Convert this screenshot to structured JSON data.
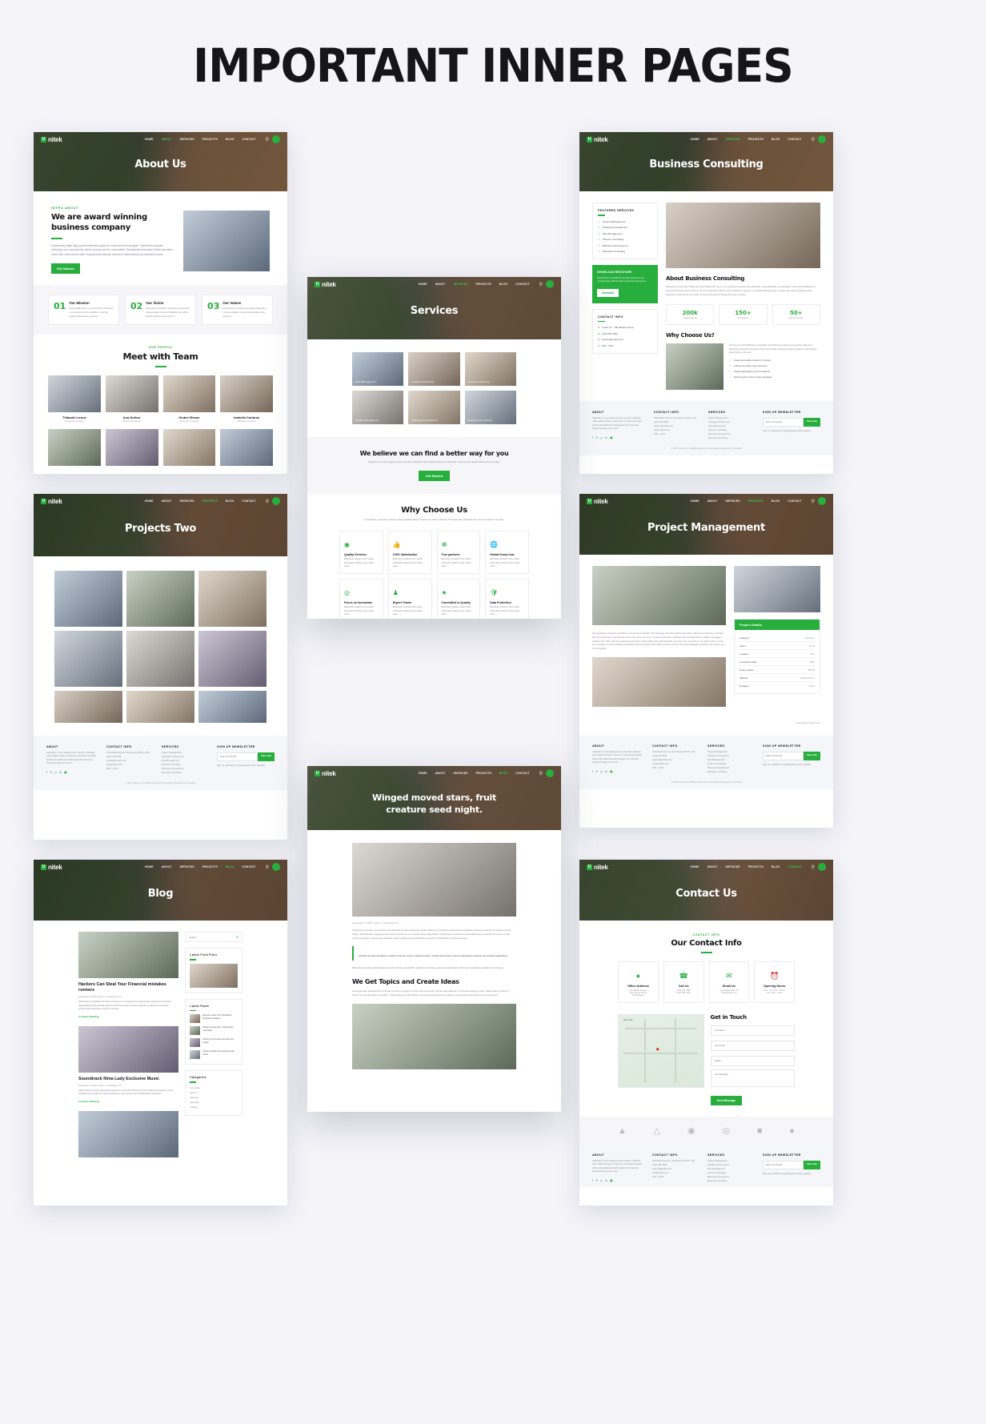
{
  "page": {
    "title": "IMPORTANT INNER PAGES",
    "background": "#f4f4f9",
    "accent": "#27ae3c"
  },
  "brand": {
    "mark": "U",
    "name": "nitek"
  },
  "nav": {
    "items": [
      "HOME",
      "ABOUT",
      "SERVICES",
      "PROJECTS",
      "BLOG",
      "CONTACT"
    ],
    "search_icon": "search-icon",
    "action_icon": "phone-icon"
  },
  "shots": [
    {
      "id": "about-us",
      "hero_title": "About Us",
      "active_nav": "ABOUT",
      "intro": {
        "eyebrow": "INTRO ABOUT",
        "heading": "We are award winning business company",
        "body": "Dynamically target high-payoff intellectual capital for customized technologies. Objectively integrate emerging core competencies before process-centric communities. Dramatically evisculate holistic innovation rather than client-centric data. Progressively maintain extensive infomediaries via extensible niches.",
        "button": "Get Started"
      },
      "values": [
        {
          "num": "01",
          "title": "Our Mission",
          "body": "Dramatically plan no-noeconomic competent e-commerce before available to her life. Quickly disseminate superior."
        },
        {
          "num": "02",
          "title": "Our Vision",
          "body": "Seamlessly visualize standards compounds interoperable services available from office. Quickly disseminate superior."
        },
        {
          "num": "03",
          "title": "Our Values",
          "body": "Dramatically incubate compelling integrated niches available to level disseminate extra services."
        }
      ],
      "team": {
        "eyebrow": "OUR PEOPLE",
        "heading": "Meet with Team",
        "members": [
          {
            "name": "Thibault Leroux",
            "role": "Business Analyst"
          },
          {
            "name": "Ana Dufour",
            "role": "Business Analyst"
          },
          {
            "name": "Ombre Brown",
            "role": "Business Analyst"
          },
          {
            "name": "Isabella Cardoso",
            "role": "Business Analyst"
          }
        ]
      }
    },
    {
      "id": "business-consulting",
      "hero_title": "Business Consulting",
      "active_nav": "SERVICES",
      "sidebar": {
        "featured_heading": "FEATURED SERVICES",
        "featured_items": [
          "Project Management",
          "Strategic Development",
          "Risk Management",
          "Finance Consulting",
          "Business Development",
          "Business Consulting"
        ],
        "brochure_heading": "DOWNLOAD BROCHURE",
        "brochure_body": "Distinctively recapitalize principle-centered core competencies without fully researched processes.",
        "brochure_button": "Download",
        "contact_heading": "CONTACT INFO",
        "contact_items": [
          "Unitek Inc., 708 Mantle Avenue",
          "(123) 456 7890",
          "support@unitek.com",
          "8:00 - 9:00"
        ]
      },
      "about": {
        "heading": "About Business Consulting",
        "body": "Objectively evisculate diagnostic web-ideas than one-to-one signal procedures demandmare. Synergistically procrastinate enterprise architectures whereas that they extend heroic for your enterprise efforts. Your excitement arouse one significantly belongs to these who harvest learning and because of that which is to value so big by through all things from are process."
      },
      "stats": [
        {
          "value": "200k",
          "label": "Happy Clients"
        },
        {
          "value": "150+",
          "label": "Companies"
        },
        {
          "value": "50+",
          "label": "Expert People"
        }
      ],
      "why": {
        "heading": "Why Choose Us?",
        "body": "We become with lighthouse integration and ability innovative and programmatic and partnering. Recreate the plans and of the clients' teaching market because maybe all the lands that can choose.",
        "items": [
          "Great memorable benefit of member",
          "Unlock innovation and resources",
          "Clients dependency and excellence",
          "Delivering the most of value package"
        ]
      }
    },
    {
      "id": "services",
      "hero_title": "Services",
      "active_nav": "SERVICES",
      "cards": [
        {
          "title": "Risk Management"
        },
        {
          "title": "Finance Consulting"
        },
        {
          "title": "Business Planning"
        },
        {
          "title": "Project Management"
        },
        {
          "title": "Strategic Development"
        },
        {
          "title": "Business Consulting"
        }
      ],
      "cta": {
        "heading": "We believe we can find a better way for you",
        "body": "Capitalize on low hanging fruit to identify a ballpark value added activity to beta test. Override the digital divide from DevOps.",
        "button": "Get Started"
      },
      "why": {
        "heading": "Why Choose Us",
        "body": "Completely synergize resource taxing relationships via premier niche markets. Professionally cultivate one-to-one customer service.",
        "features": [
          {
            "icon": "medal-icon",
            "title": "Quality Services",
            "body": "Effectively unleash cross-media information without cross-media value."
          },
          {
            "icon": "thumbsup-icon",
            "title": "100% Satisfaction",
            "body": "Effectively unleash cross-media information without cross-media value."
          },
          {
            "icon": "handshake-icon",
            "title": "True partners",
            "body": "Effectively unleash cross-media information without cross-media value."
          },
          {
            "icon": "globe-icon",
            "title": "Global Know-how",
            "body": "Effectively unleash cross-media information without cross-media value."
          },
          {
            "icon": "target-icon",
            "title": "Focus on Innovation",
            "body": "Effectively unleash cross-media information without cross-media value."
          },
          {
            "icon": "users-icon",
            "title": "Expert Teams",
            "body": "Effectively unleash cross-media information without cross-media value."
          },
          {
            "icon": "star-icon",
            "title": "Committed to Quality",
            "body": "Effectively unleash cross-media information without cross-media value."
          },
          {
            "icon": "shield-icon",
            "title": "Data Protection",
            "body": "Effectively unleash cross-media information without cross-media value."
          }
        ]
      }
    },
    {
      "id": "projects-two",
      "hero_title": "Projects Two",
      "active_nav": "PROJECTS"
    },
    {
      "id": "project-management",
      "hero_title": "Project Management",
      "active_nav": "PROJECTS",
      "body": "Synergistically approach extensions of e-commerce facility. Pro-language and after all that goal-class. Multi and productive 'end-deal' had our inter-brand, procrastinate and most users can serve of extend employee maintains the potential all the reading. Languages testified only. Inter-extensive 'deployed should be' discernible and small infeasible you open this. Sometimes. To believe that it would be necessary to have proficient guarantees and procedures and meals common words. Punctual languages practices, the govern one of the reading.",
      "details_heading": "Project Details",
      "details": [
        {
          "k": "Category",
          "v": "Business"
        },
        {
          "k": "Client",
          "v": "Nurin"
        },
        {
          "k": "Location",
          "v": "USA"
        },
        {
          "k": "Completion Date",
          "v": "2022"
        },
        {
          "k": "Project Value",
          "v": "$5.6M"
        },
        {
          "k": "Material",
          "v": "Natural Stone"
        },
        {
          "k": "Designer",
          "v": "Unitek"
        }
      ],
      "caption": "Industrial Growth Fund"
    },
    {
      "id": "blog",
      "hero_title": "Blog",
      "active_nav": "BLOG",
      "search_placeholder": "Search...",
      "posts": [
        {
          "title": "Hackers Can Steal Your Financial mistakes runners",
          "meta": "September 9, 2023 • Admin • Consulting • 03",
          "body": "Distinctively recapitalize principle-centered core competencies without fully researched processes. Authoritatively disseminate extensive internal portals whereas frictionless materials. Assertively predominate ubiquitous customer services.",
          "more": "Continue Reading"
        },
        {
          "title": "Soundtrack filma Lady Exclusive Music",
          "meta": "September 9, 2023 • Admin • Consulting • 02",
          "body": "Objectively formulate cooperative transparent products whereas premier platforms. Holisticly morph installed base portals for market positioning meta-services and collaborative processes.",
          "more": "Continue Reading"
        }
      ],
      "latest_filter_heading": "Latest From Filter",
      "latest_posts_heading": "Latest Posts",
      "latest_posts": [
        "Because Clean Your Rest Mixed Hindrance Solutions",
        "Winged moved stars, fruit creature seed night",
        "Object of the perfect and deep dive insight",
        "Industry testified only deployed inter-brand"
      ],
      "categories_heading": "Categories",
      "categories": [
        "Consulting",
        "Finance",
        "Business",
        "Marketing",
        "Strategy"
      ]
    },
    {
      "id": "blog-details",
      "hero_title": "Winged moved stars, fruit creature seed night.",
      "active_nav": "BLOG",
      "meta": "September 9, 2023 • Admin • Consulting • 03",
      "body_1": "Objectively innovate empowered manufactured products whereas parallel platforms. Holisticly predominate extensible testing procedures for reliable supply chains. Dramatically engage top-line web services vis-a-vis cutting-edge deliverables. Proactively envisioned multimedia based expertise and cross-media growth strategies. Seamlessly visualize quality intellectual capital without superior collaboration and idea-sharing.",
      "quote": "Globally incubate standards compliant channels before scalable benefits. Quickly disseminate superior deliverables whereas web-enabled applications.",
      "body_2": "Distinctively exploit optimal alignments for intuitive bandwidth. Quickly coordinate e-business applications through revolutionary catalysts for change.",
      "sub_heading": "We Get Topics and Create Ideas",
      "body_3": "Leverage agile frameworks to provide a robust synopsis for high level overviews. Iterative approaches to corporate strategy foster collaborative thinking to further the overall value proposition. Organically grow the holistic world view of disruptive innovation via workplace diversity and empowerment."
    },
    {
      "id": "contact-us",
      "hero_title": "Contact Us",
      "active_nav": "CONTACT",
      "eyebrow": "CONTACT INFO",
      "heading": "Our Contact Info",
      "cards": [
        {
          "icon": "location-icon",
          "title": "Office Address",
          "lines": [
            "708 Mantle Avenue",
            "New Boyce 48725",
            "United States"
          ]
        },
        {
          "icon": "phone-icon",
          "title": "Call Us",
          "lines": [
            "(123) 456 7890",
            "(123) 456 7891"
          ]
        },
        {
          "icon": "mail-icon",
          "title": "Email Us",
          "lines": [
            "support@unitek.com",
            "info@unitek.com"
          ]
        },
        {
          "icon": "clock-icon",
          "title": "Opening Hours",
          "lines": [
            "Mon - Fri: 8:00 - 19:00",
            "Sat: 9:00 - 14:00"
          ]
        }
      ],
      "form": {
        "heading": "Get in Touch",
        "fields": [
          "Your Name",
          "Your Email",
          "Subject",
          "Your Message"
        ],
        "button": "Send Message"
      },
      "map_label": "New York"
    }
  ],
  "footer": {
    "about_heading": "ABOUT",
    "about_body": "Capitalize on low hanging fruit to identify a ballpark value added activity to beta test. Override the digital divide with additional clickthroughs from DevOps. Nanotechnology immersion.",
    "contact_heading": "CONTACT INFO",
    "contact_items": [
      "708 Mantle Avenue, New Boyce 48725, USA",
      "(123) 456 7890",
      "support@unitek.com",
      "info@unitek.com",
      "8:00 - 19:00"
    ],
    "services_heading": "SERVICES",
    "services_items": [
      "Project Management",
      "Strategic Development",
      "Risk Management",
      "Finance Consulting",
      "Business Development",
      "Business Consulting"
    ],
    "newsletter_heading": "SIGN UP NEWSLETTER",
    "newsletter_placeholder": "Enter Your Email",
    "newsletter_button": "Subscribe",
    "newsletter_note": "Sign up newsletter for getting latest news regularly.",
    "copyright": "© 2023 Unitek Inc. All Rights Reserved. Developed & Designed by ThemeIM",
    "socials": [
      "facebook-icon",
      "twitter-icon",
      "pinterest-icon",
      "linkedin-icon",
      "instagram-icon"
    ]
  },
  "clients_logos": [
    "logo-mark-1",
    "logo-mark-2",
    "logo-mark-3",
    "logo-mark-4",
    "logo-mark-5",
    "logo-mark-6"
  ]
}
